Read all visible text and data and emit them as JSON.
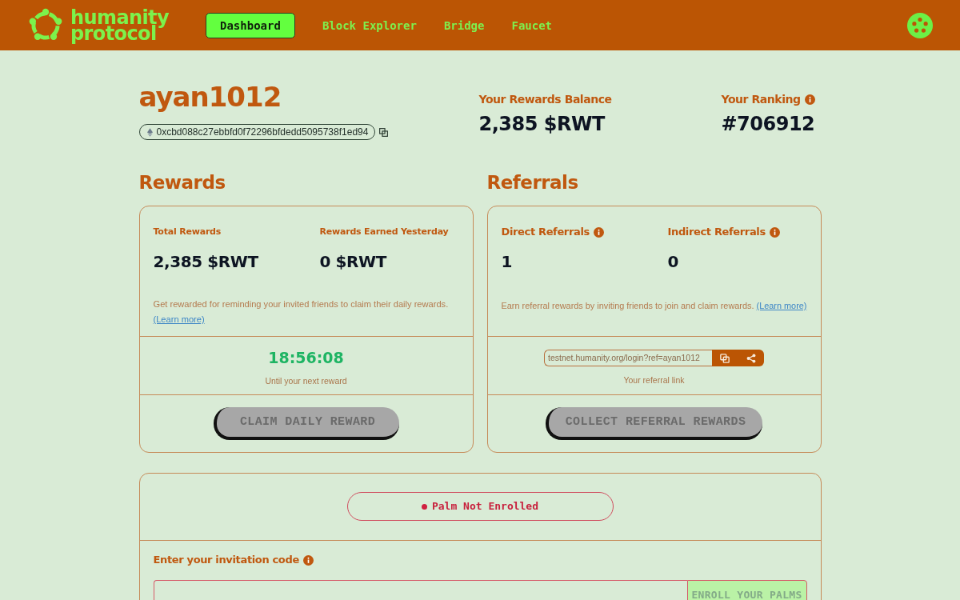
{
  "header": {
    "brand": "humanity protocol",
    "nav": [
      {
        "label": "Dashboard",
        "selected": true
      },
      {
        "label": "Block Explorer",
        "selected": false
      },
      {
        "label": "Bridge",
        "selected": false
      },
      {
        "label": "Faucet",
        "selected": false
      }
    ]
  },
  "profile": {
    "username": "ayan1012",
    "address": "0xcbd088c27ebbfd0f72296bfdedd5095738f1ed94"
  },
  "summary": [
    {
      "label": "Your Rewards Balance",
      "value": "2,385 $RWT",
      "info_icon": false
    },
    {
      "label": "Your Ranking",
      "value": "#706912",
      "info_icon": true
    }
  ],
  "rewards": {
    "title": "Rewards",
    "stats": [
      {
        "label": "Total Rewards",
        "value": "2,385 $RWT",
        "info_icon": false
      },
      {
        "label": "Rewards Earned Yesterday",
        "value": "0 $RWT",
        "info_icon": false
      }
    ],
    "description": "Get rewarded for reminding your invited friends to claim their daily rewards.",
    "learn_more": "(Learn more)",
    "timer": "18:56:08",
    "timer_caption": "Until your next reward",
    "button": {
      "label": "CLAIM DAILY REWARD",
      "disabled": true
    }
  },
  "referrals": {
    "title": "Referrals",
    "stats": [
      {
        "label": "Direct Referrals",
        "value": "1",
        "info_icon": true
      },
      {
        "label": "Indirect Referrals",
        "value": "0",
        "info_icon": true
      }
    ],
    "description": "Earn referral rewards by inviting friends to join and claim rewards.",
    "learn_more": "(Learn more)",
    "referral_link": "testnet.humanity.org/login?ref=ayan1012",
    "link_caption": "Your referral link",
    "button": {
      "label": "COLLECT REFERRAL REWARDS",
      "disabled": true
    }
  },
  "palm": {
    "status": "Palm Not Enrolled",
    "enrolled": false,
    "invitation_label": "Enter your invitation code",
    "enroll_button": {
      "label": "ENROLL YOUR PALMS",
      "disabled": true
    }
  }
}
